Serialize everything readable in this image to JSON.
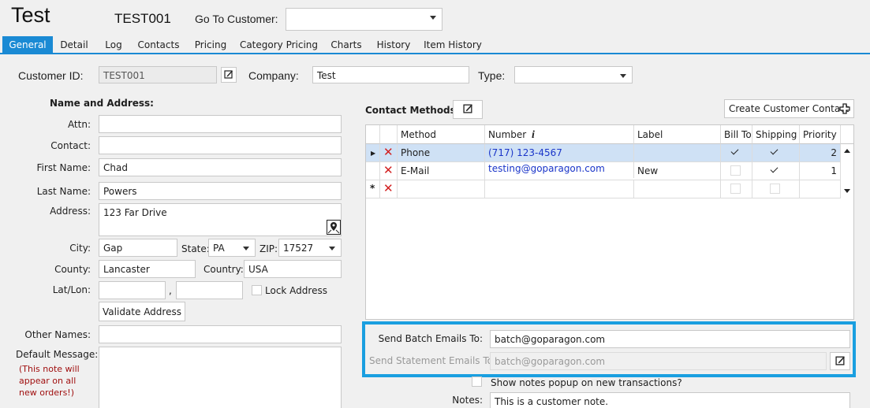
{
  "header": {
    "title": "Test",
    "account_number": "TEST001",
    "goto_label": "Go To Customer:",
    "goto_value": ""
  },
  "tabs": [
    "General",
    "Detail",
    "Log",
    "Contacts",
    "Pricing",
    "Category Pricing",
    "Charts",
    "History",
    "Item History"
  ],
  "active_tab": "General",
  "top_fields": {
    "customer_id_label": "Customer ID:",
    "customer_id_value": "TEST001",
    "company_label": "Company:",
    "company_value": "Test",
    "type_label": "Type:",
    "type_value": ""
  },
  "name_address": {
    "section_title": "Name and Address:",
    "attn_label": "Attn:",
    "attn_value": "",
    "contact_label": "Contact:",
    "contact_value": "",
    "first_name_label": "First Name:",
    "first_name_value": "Chad",
    "last_name_label": "Last Name:",
    "last_name_value": "Powers",
    "address_label": "Address:",
    "address_value": "123 Far Drive",
    "city_label": "City:",
    "city_value": "Gap",
    "state_label": "State:",
    "state_value": "PA",
    "zip_label": "ZIP:",
    "zip_value": "17527",
    "county_label": "County:",
    "county_value": "Lancaster",
    "country_label": "Country:",
    "country_value": "USA",
    "latlon_label": "Lat/Lon:",
    "lat_value": "",
    "lon_value": "",
    "latlon_sep": ",",
    "lock_address_label": "Lock Address",
    "lock_address_checked": false,
    "validate_button": "Validate Address",
    "other_names_label": "Other Names:",
    "other_names_value": "",
    "default_message_label": "Default Message:",
    "default_message_note": "(This note will appear on all new orders!)",
    "default_message_value": ""
  },
  "contact_methods": {
    "section_title": "Contact Methods:",
    "create_button": "Create Customer Contact",
    "columns": [
      "Method",
      "Number",
      "Label",
      "Bill To",
      "Shipping",
      "Priority"
    ],
    "rows": [
      {
        "method": "Phone",
        "number": "(717) 123-4567",
        "label": "",
        "bill_to": true,
        "shipping": true,
        "priority": "2"
      },
      {
        "method": "E-Mail",
        "number": "testing@goparagon.com",
        "label": "New",
        "bill_to": false,
        "shipping": true,
        "priority": "1"
      }
    ]
  },
  "emails": {
    "batch_label": "Send Batch Emails To:",
    "batch_value": "batch@goparagon.com",
    "statement_label": "Send Statement Emails To:",
    "statement_value": "batch@goparagon.com"
  },
  "notes": {
    "popup_label": "Show notes popup on new transactions?",
    "popup_checked": false,
    "notes_label": "Notes:",
    "notes_value": "This is a customer note."
  },
  "colors": {
    "accent": "#1a8ad4",
    "highlight_border": "#1a9fe0",
    "selected_row": "#cfe1f5",
    "warning_text": "#a01010",
    "link": "#1a35c9",
    "delete": "#d21f1f"
  }
}
